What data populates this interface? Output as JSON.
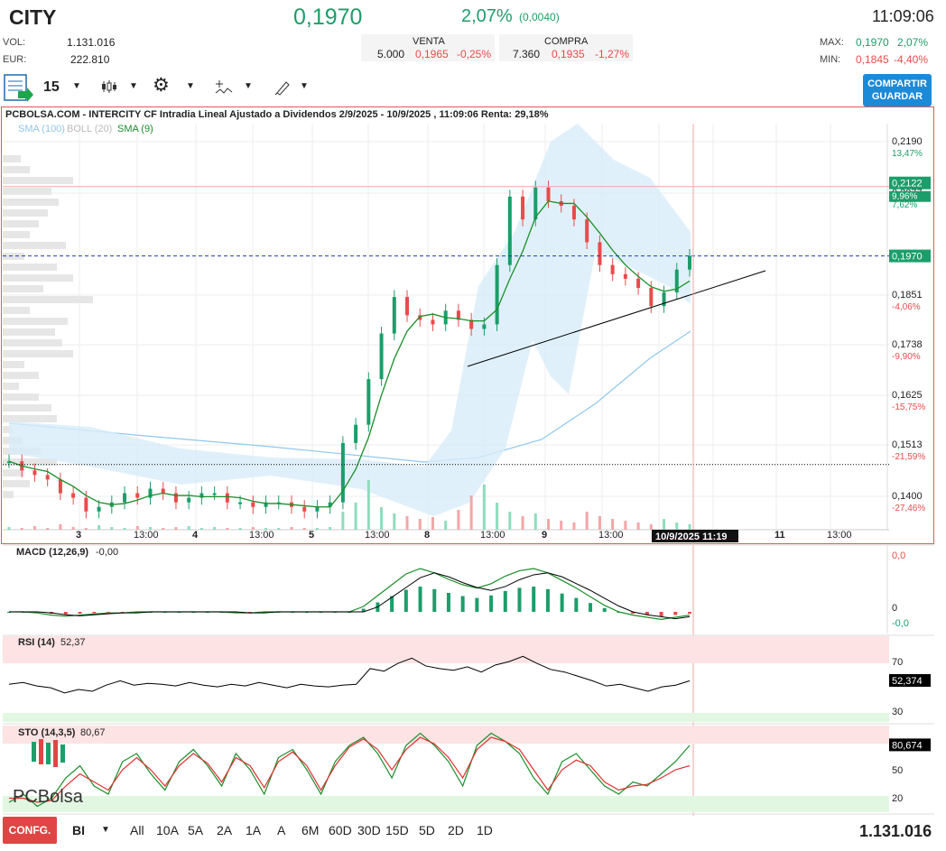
{
  "header": {
    "symbol": "CITY",
    "price": "0,1970",
    "change_pct": "2,07%",
    "change_abs": "(0,0040)",
    "time": "11:09:06",
    "vol_label": "VOL:",
    "vol_value": "1.131.016",
    "eur_label": "EUR:",
    "eur_value": "222.810",
    "venta_label": "VENTA",
    "venta_qty": "5.000",
    "venta_price": "0,1965",
    "venta_pct": "-0,25%",
    "compra_label": "COMPRA",
    "compra_qty": "7.360",
    "compra_price": "0,1935",
    "compra_pct": "-1,27%",
    "max_label": "MAX:",
    "max_price": "0,1970",
    "max_pct": "2,07%",
    "min_label": "MIN:",
    "min_price": "0,1845",
    "min_pct": "-4,40%"
  },
  "toolbar": {
    "interval": "15",
    "share_line1": "COMPARTIR",
    "share_line2": "GUARDAR"
  },
  "chart": {
    "title": "PCBOLSA.COM - INTERCITY CF Intradia Lineal Ajustado a Dividendos 2/9/2025 - 10/9/2025 , 11:09:06 Renta: 29,18%",
    "legend_sma100": "SMA (100)",
    "legend_boll": "BOLL (20)",
    "legend_sma9": "SMA (9)",
    "price_tag": "0,1970",
    "price_tag2": "0,2122",
    "price_tag2_pct": "9,96%",
    "cursor_label": "10/9/2025 11:19",
    "macd_label": "MACD (12,26,9)",
    "macd_value": "-0,00",
    "macd_top": "0,0",
    "macd_zero": "0",
    "macd_bottom": "-0,0",
    "rsi_label": "RSI (14)",
    "rsi_value": "52,37",
    "rsi_tag": "52,374",
    "rsi_70": "70",
    "rsi_30": "30",
    "sto_label": "STO (14,3,5)",
    "sto_value": "80,67",
    "sto_tag": "80,674",
    "sto_50": "50",
    "sto_20": "20",
    "logo": "PCBolsa"
  },
  "chart_data": {
    "type": "candlestick",
    "title": "PCBOLSA.COM - INTERCITY CF Intradia Lineal Ajustado a Dividendos 2/9/2025 - 10/9/2025 , 11:09:06 Renta: 29,18%",
    "y_ticks": [
      {
        "price": "0,2190",
        "pct": "13,47%"
      },
      {
        "price": "0,2077",
        "pct": "7,62%"
      },
      {
        "price": "0,1851",
        "pct": "-4,06%"
      },
      {
        "price": "0,1738",
        "pct": "-9,90%"
      },
      {
        "price": "0,1625",
        "pct": "-15,75%"
      },
      {
        "price": "0,1513",
        "pct": "-21,59%"
      },
      {
        "price": "0,1400",
        "pct": "-27,46%"
      }
    ],
    "x_ticks": [
      "3",
      "13:00",
      "4",
      "13:00",
      "5",
      "13:00",
      "8",
      "13:00",
      "9",
      "13:00",
      "11",
      "13:00"
    ],
    "ylim": [
      0.137,
      0.225
    ],
    "last_price": 0.197,
    "ref_line": 0.1513,
    "high_line": 0.2122,
    "close": [
      0.152,
      0.15,
      0.149,
      0.148,
      0.145,
      0.144,
      0.141,
      0.142,
      0.143,
      0.145,
      0.144,
      0.146,
      0.145,
      0.143,
      0.144,
      0.145,
      0.145,
      0.143,
      0.143,
      0.142,
      0.143,
      0.143,
      0.142,
      0.141,
      0.142,
      0.143,
      0.156,
      0.16,
      0.17,
      0.18,
      0.188,
      0.184,
      0.183,
      0.182,
      0.185,
      0.183,
      0.181,
      0.182,
      0.195,
      0.21,
      0.205,
      0.212,
      0.209,
      0.208,
      0.205,
      0.2,
      0.195,
      0.193,
      0.192,
      0.19,
      0.186,
      0.189,
      0.194,
      0.197
    ]
  },
  "indicators": {
    "macd": [
      0,
      0,
      -0.1,
      -0.3,
      -0.4,
      -0.3,
      -0.2,
      -0.1,
      -0.1,
      0,
      0,
      0,
      0,
      0,
      0,
      0,
      -0.1,
      -0.1,
      0,
      0,
      0,
      0,
      0,
      0,
      0,
      0.5,
      1.5,
      2.5,
      3.5,
      4.0,
      3.6,
      3.0,
      2.5,
      2.2,
      2.6,
      3.3,
      3.8,
      4.0,
      3.6,
      2.9,
      2.2,
      1.4,
      0.6,
      0,
      -0.3,
      -0.5,
      -0.7,
      -0.5,
      -0.3
    ],
    "rsi": [
      48,
      50,
      46,
      44,
      38,
      42,
      40,
      47,
      52,
      47,
      49,
      48,
      46,
      50,
      47,
      45,
      48,
      46,
      50,
      47,
      44,
      48,
      46,
      45,
      47,
      48,
      66,
      63,
      72,
      78,
      69,
      66,
      64,
      68,
      62,
      70,
      74,
      80,
      72,
      65,
      62,
      57,
      52,
      46,
      48,
      44,
      40,
      45,
      47,
      52
    ],
    "sto": [
      10,
      20,
      5,
      15,
      40,
      55,
      30,
      20,
      60,
      70,
      45,
      25,
      60,
      75,
      55,
      30,
      70,
      50,
      20,
      65,
      75,
      50,
      20,
      60,
      80,
      90,
      70,
      40,
      80,
      95,
      80,
      60,
      30,
      80,
      95,
      85,
      70,
      40,
      20,
      60,
      70,
      50,
      30,
      20,
      35,
      30,
      45,
      60,
      80
    ],
    "sto_signal": [
      15,
      15,
      10,
      12,
      30,
      45,
      35,
      25,
      50,
      65,
      50,
      30,
      55,
      70,
      58,
      35,
      65,
      55,
      28,
      60,
      72,
      55,
      25,
      55,
      78,
      88,
      75,
      50,
      75,
      90,
      82,
      65,
      40,
      75,
      90,
      85,
      75,
      50,
      25,
      50,
      62,
      55,
      35,
      25,
      30,
      32,
      40,
      50,
      55
    ]
  },
  "ranges": [
    "BI",
    "All",
    "10A",
    "5A",
    "2A",
    "1A",
    "A",
    "6M",
    "60D",
    "30D",
    "15D",
    "5D",
    "2D",
    "1D"
  ],
  "footer": {
    "config": "CONFG.",
    "volume_total": "1.131.016"
  },
  "colors": {
    "up": "#1c9e6a",
    "down": "#e94b4b",
    "share": "#1b8ad8",
    "config": "#e04545",
    "boll_fill": "#d8ecf9",
    "sma9": "#1a8f2a",
    "sma100": "#8fc8ec"
  }
}
